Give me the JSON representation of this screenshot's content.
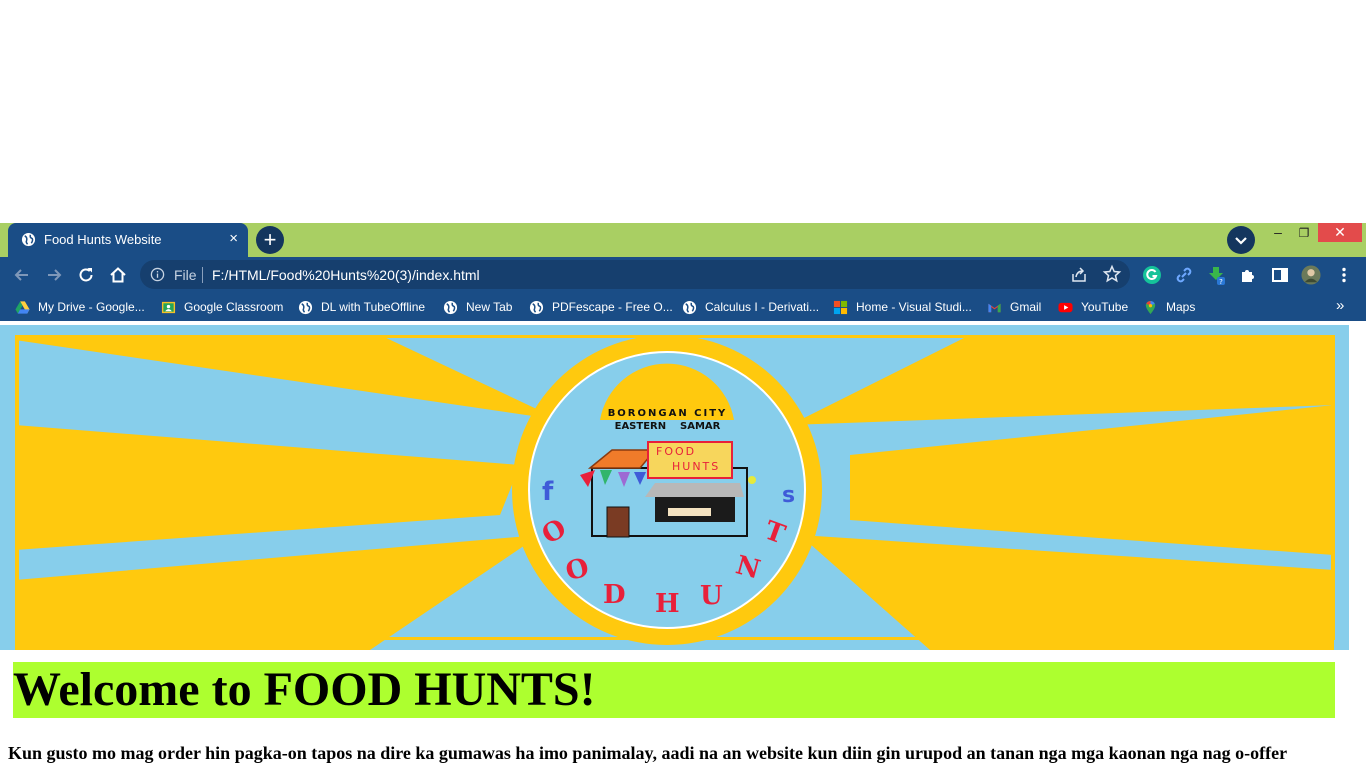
{
  "browser": {
    "tab": {
      "title": "Food Hunts Website",
      "close_glyph": "×"
    },
    "new_tab_glyph": "+",
    "window_controls": {
      "minimize": "–",
      "maximize": "❐",
      "close": "✕"
    },
    "address": {
      "scheme_label": "File",
      "url": "F:/HTML/Food%20Hunts%20(3)/index.html"
    },
    "bookmarks": [
      {
        "label": "My Drive - Google...",
        "icon": "google-drive-icon"
      },
      {
        "label": "Google Classroom",
        "icon": "google-classroom-icon"
      },
      {
        "label": "DL with TubeOffline",
        "icon": "globe-icon"
      },
      {
        "label": "New Tab",
        "icon": "globe-icon"
      },
      {
        "label": "PDFescape - Free O...",
        "icon": "globe-icon"
      },
      {
        "label": "Calculus I - Derivati...",
        "icon": "globe-icon"
      },
      {
        "label": "Home - Visual Studi...",
        "icon": "microsoft-icon"
      },
      {
        "label": "Gmail",
        "icon": "gmail-icon"
      },
      {
        "label": "YouTube",
        "icon": "youtube-icon"
      },
      {
        "label": "Maps",
        "icon": "google-maps-icon"
      }
    ],
    "bookmarks_more_glyph": "»"
  },
  "page": {
    "logo": {
      "top_line": "BORONGAN CITY",
      "sub_line": "EASTERN    SAMAR",
      "sign_line1": "FOOD",
      "sign_line2": "HUNTS",
      "ring_letters": [
        "f",
        "O",
        "O",
        "D",
        "H",
        "U",
        "N",
        "T",
        "s"
      ]
    },
    "heading": "Welcome to FOOD HUNTS!",
    "paragraph": "Kun gusto mo mag order hin pagka-on tapos na dire ka gumawas ha imo panimalay, aadi na an website kun diin gin urupod an tanan nga mga kaonan nga nag o-offer"
  },
  "colors": {
    "titlebar": "#a9cf63",
    "toolbar": "#1a4d86",
    "banner_sky": "#87ceeb",
    "banner_rays": "#ffc90e",
    "heading_bg": "#adff2f",
    "logo_letters_red": "#e8203a",
    "logo_letters_blue": "#3f5bd8"
  }
}
